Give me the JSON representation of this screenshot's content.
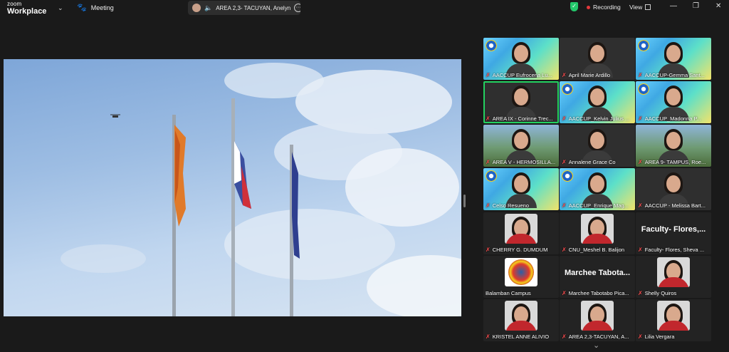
{
  "app": {
    "brand_top": "zoom",
    "brand_bottom": "Workplace",
    "meeting_label": "Meeting",
    "active_speaker": "AREA 2,3- TACUYAN, Anelyn",
    "recording_label": "Recording",
    "view_label": "View"
  },
  "colors": {
    "recording_dot": "#e5383b",
    "security_shield": "#23c86b",
    "active_speaker_border": "#23d160",
    "muted_mic": "#ff4d4f"
  },
  "gallery": {
    "tiles": [
      {
        "name": "AACCUP Eufrocena Lu...",
        "muted": true,
        "style": "banner"
      },
      {
        "name": "April Marie Ardillo",
        "muted": true,
        "style": "photo"
      },
      {
        "name": "AACCUP-Gemma Sant...",
        "muted": true,
        "style": "banner"
      },
      {
        "name": "AREA IX - Corinne Trec...",
        "muted": true,
        "style": "photo",
        "active": true
      },
      {
        "name": "AACCUP_Kelvin Julius ...",
        "muted": true,
        "style": "banner"
      },
      {
        "name": "AACCUP_Madonna P...",
        "muted": true,
        "style": "banner"
      },
      {
        "name": "AREA V - HERMOSILLA...",
        "muted": true,
        "style": "campus"
      },
      {
        "name": "Annalene Grace Co",
        "muted": true,
        "style": "photo"
      },
      {
        "name": "AREA 9- TAMPUS, Roe...",
        "muted": true,
        "style": "campus"
      },
      {
        "name": "Celso Resueno",
        "muted": true,
        "style": "banner"
      },
      {
        "name": "AACCUP_Enrique Mag...",
        "muted": true,
        "style": "banner"
      },
      {
        "name": "AACCUP - Melissa Bart...",
        "muted": true,
        "style": "photo"
      },
      {
        "name": "CHERRY G. DUMDUM",
        "muted": true,
        "style": "dark"
      },
      {
        "name": "CNU_Meshel B. Balijon",
        "muted": true,
        "style": "dark"
      },
      {
        "name": "Faculty- Flores, Sheva ...",
        "muted": true,
        "style": "dark",
        "bigname": "Faculty-  Flores,..."
      },
      {
        "name": "Balamban Campus",
        "muted": false,
        "style": "dark"
      },
      {
        "name": "Marchee Tabotabo Pica...",
        "muted": true,
        "style": "dark",
        "bigname": "Marchee  Tabota..."
      },
      {
        "name": "Shelly Quiros",
        "muted": true,
        "style": "dark"
      },
      {
        "name": "KRISTEL ANNE ALIVIO",
        "muted": true,
        "style": "dark"
      },
      {
        "name": "AREA 2,3-TACUYAN, A...",
        "muted": true,
        "style": "dark"
      },
      {
        "name": "Lilia Vergara",
        "muted": true,
        "style": "dark"
      }
    ]
  }
}
